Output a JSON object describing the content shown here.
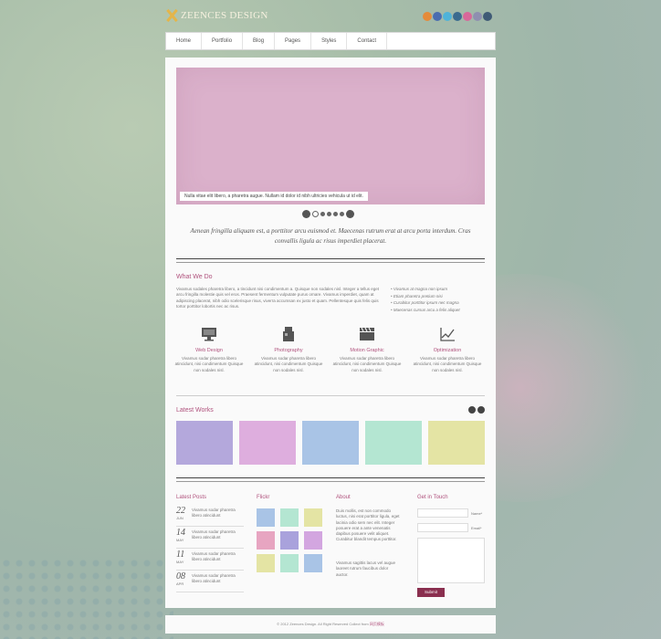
{
  "brand": {
    "name": "ZEENCES DESIGN"
  },
  "social_icons": [
    {
      "name": "rss-icon",
      "color": "#e58b3a"
    },
    {
      "name": "facebook-icon",
      "color": "#4a6db0"
    },
    {
      "name": "twitter-icon",
      "color": "#4fb3d9"
    },
    {
      "name": "vimeo-icon",
      "color": "#3b6b8f"
    },
    {
      "name": "dribbble-icon",
      "color": "#d8679a"
    },
    {
      "name": "flickr-icon",
      "color": "#8f8fb0"
    },
    {
      "name": "tumblr-icon",
      "color": "#3f5a76"
    }
  ],
  "nav": [
    "Home",
    "Portfolio",
    "Blog",
    "Pages",
    "Styles",
    "Contact"
  ],
  "slider": {
    "caption": "Nulla vitae elit libero, a pharetra augue. Nullam id dolor id nibh ultricies vehicula ut id elit.",
    "dot_count": 5
  },
  "tagline": "Aenean fringilla aliquam est, a porttitor arcu euismod et. Maecenas rutrum erat at arcu porta interdum. Cras convallis ligula ac risus imperdiet placerat.",
  "what_we_do": {
    "title": "What We Do",
    "text": "Vivamus sodales pharetra libero, a tincidunt nisi condimentum a. Quisque non sodales nisl. Integer a tellus eget arcu fringilla molestie quis vel eros. Praesent fermentum vulputate purus ornare. Vivamus imperdiet, quam at adipiscing placerat, nibh odio scelerisque risus, viverra accumsan ex justo et quam. Pellentesque quis felis quis tortor porttitor lobortis nec ac risus.",
    "bullets": [
      "Vivamus at magna non ipsum",
      "Etiam pharetra pretium nisi",
      "Curabitur porttitor ipsum nec magna",
      "Maecenas cursus arcu a felis aliquet"
    ]
  },
  "services": [
    {
      "icon": "monitor-icon",
      "title": "Web Design",
      "desc": "Vivamus sodar pharetra libero atincidunt, nisi condimentum Quisque non sodales nisl."
    },
    {
      "icon": "film-camera-icon",
      "title": "Photography",
      "desc": "Vivamus sodar pharetra libero atincidunt, nisi condimentum Quisque non sodales nisl."
    },
    {
      "icon": "clapperboard-icon",
      "title": "Motion Graphic",
      "desc": "Vivamus sodar pharetra libero atincidunt, nisi condimentum Quisque non sodales nisl."
    },
    {
      "icon": "line-chart-icon",
      "title": "Optimization",
      "desc": "Vivamus sodar pharetra libero atincidunt, nisi condimentum Quisque non sodales nisl."
    }
  ],
  "latest_works": {
    "title": "Latest Works",
    "colors": [
      "#b4a8dc",
      "#deaede",
      "#a9c4e6",
      "#b4e6d2",
      "#e4e4a4"
    ]
  },
  "latest_posts": {
    "title": "Latest Posts",
    "items": [
      {
        "day": "22",
        "month": "JUN",
        "text": "Vivamus sodar pharetra libero atincidunt"
      },
      {
        "day": "14",
        "month": "MAY",
        "text": "Vivamus sodar pharetra libero atincidunt"
      },
      {
        "day": "11",
        "month": "MAY",
        "text": "Vivamus sodar pharetra libero atincidunt"
      },
      {
        "day": "08",
        "month": "APR",
        "text": "Vivamus sodar pharetra libero atincidunt"
      }
    ]
  },
  "flickr": {
    "title": "Flickr",
    "colors": [
      "#a9c4e6",
      "#b4e6d2",
      "#e4e4a4",
      "#e7a5c1",
      "#a9a2dc",
      "#d3a6e0",
      "#e4e4a4",
      "#b4e6d2",
      "#a9c4e6"
    ]
  },
  "about": {
    "title": "About",
    "text1": "Duis mollis, est non commodo luctus, nisi erat porttitor ligula, eget lacinia odio sem nec elit. Integer posuere erat a ante venenatis dapibus posuere velit aliquet. Curabitur blandit tempus porttitor.",
    "text2": "Vivamus sagittis lacus vel augue laoreet rutrum faucibus dolor auctor."
  },
  "contact": {
    "title": "Get in Touch",
    "name_label": "Name*",
    "email_label": "Email*",
    "submit_label": "Submit"
  },
  "footer": {
    "text": "© 2012 Zeences Design. All Right Reserved Collect from",
    "link": "网页模板"
  }
}
